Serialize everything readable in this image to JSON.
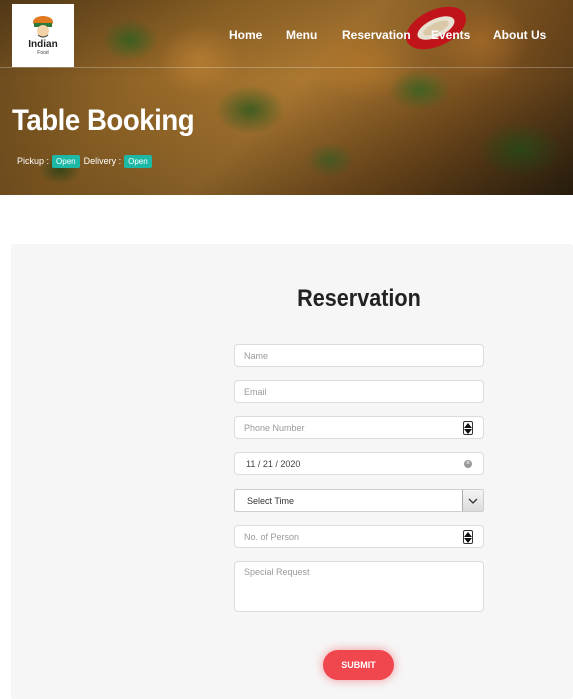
{
  "logo": {
    "name": "Indian",
    "sub": "Food"
  },
  "nav": {
    "items": [
      {
        "label": "Home"
      },
      {
        "label": "Menu"
      },
      {
        "label": "Reservation"
      },
      {
        "label": "Events"
      },
      {
        "label": "About Us"
      }
    ]
  },
  "hero": {
    "title": "Table Booking",
    "pickup_label": "Pickup :",
    "pickup_status": "Open",
    "delivery_label": "Delivery :",
    "delivery_status": "Open"
  },
  "form": {
    "title": "Reservation",
    "name_placeholder": "Name",
    "email_placeholder": "Email",
    "phone_placeholder": "Phone Number",
    "date_value": "11 / 21 / 2020",
    "time_selected": "Select Time",
    "persons_placeholder": "No. of Person",
    "request_placeholder": "Special Request",
    "submit_label": "SUBMIT"
  },
  "colors": {
    "accent": "#f0474f",
    "badge": "#1db9a6",
    "card_bg": "#f6f6f6"
  },
  "icons": [
    "logo-chef-icon",
    "chili-pepper-decor",
    "number-spinner-icon",
    "clear-date-icon",
    "chevron-down-icon"
  ]
}
